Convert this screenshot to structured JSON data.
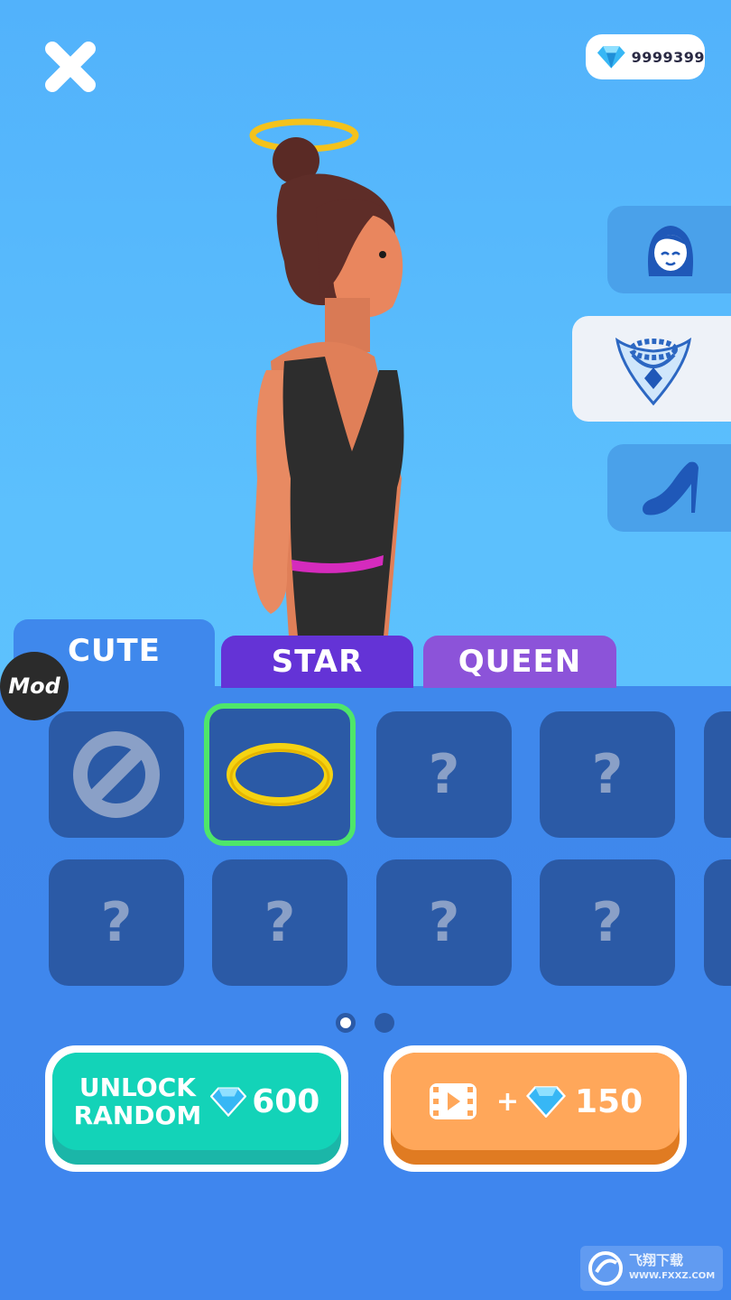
{
  "header": {
    "close_icon": "close-x-icon",
    "gem_count": "9999399"
  },
  "side_categories": [
    {
      "name": "face",
      "icon": "girl-face-icon"
    },
    {
      "name": "necklace",
      "icon": "necklace-icon",
      "selected": true
    },
    {
      "name": "shoes",
      "icon": "high-heel-icon"
    }
  ],
  "tabs": [
    {
      "label": "CUTE",
      "active": true
    },
    {
      "label": "STAR"
    },
    {
      "label": "QUEEN"
    }
  ],
  "mod_badge": "Mod",
  "slots": {
    "row1": [
      {
        "type": "none",
        "icon": "no-entry-icon"
      },
      {
        "type": "item",
        "icon": "halo-ring-icon",
        "selected": true
      },
      {
        "type": "locked",
        "text": "?"
      },
      {
        "type": "locked",
        "text": "?"
      }
    ],
    "row2": [
      {
        "type": "locked",
        "text": "?"
      },
      {
        "type": "locked",
        "text": "?"
      },
      {
        "type": "locked",
        "text": "?"
      },
      {
        "type": "locked",
        "text": "?"
      }
    ]
  },
  "pagination": {
    "pages": 2,
    "current": 1
  },
  "buttons": {
    "unlock": {
      "line1": "UNLOCK",
      "line2": "RANDOM",
      "price": "600",
      "icon": "diamond-icon"
    },
    "ad": {
      "plus": "+",
      "amount": "150",
      "icon": "video-icon"
    }
  },
  "watermark": {
    "line1": "飞翔下载",
    "line2": "WWW.FXXZ.COM"
  },
  "colors": {
    "accent_green": "#13d3b8",
    "accent_orange": "#ffa75a",
    "panel": "#3f88ec",
    "slot": "#2b5aa6"
  }
}
